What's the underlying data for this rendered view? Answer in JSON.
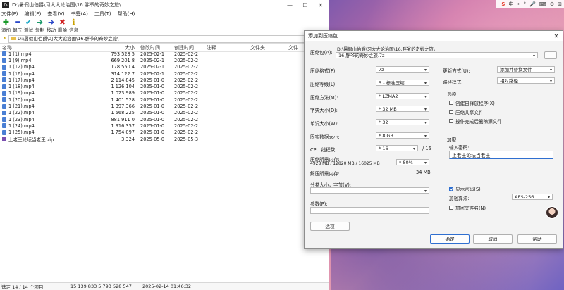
{
  "main_window": {
    "title": "D:\\暑假山伯爵\\习大大论治国\\16.胖爷的奇妙之旅\\",
    "app_icon": "7z",
    "menu": [
      "文件(F)",
      "编辑(E)",
      "查看(V)",
      "书签(A)",
      "工具(T)",
      "帮助(H)"
    ],
    "toolbar": [
      {
        "label": "添加",
        "icon": "plus-icon",
        "glyph": "✚",
        "color": "#1a9a2a"
      },
      {
        "label": "解压",
        "icon": "minus-icon",
        "glyph": "━",
        "color": "#2a48c8"
      },
      {
        "label": "测试",
        "icon": "check-icon",
        "glyph": "✔",
        "color": "#1aa8c8"
      },
      {
        "label": "复制",
        "icon": "copy-arrow-icon",
        "glyph": "➜",
        "color": "#1a9a6a"
      },
      {
        "label": "移动",
        "icon": "move-arrow-icon",
        "glyph": "➜",
        "color": "#2a48c8"
      },
      {
        "label": "删除",
        "icon": "delete-icon",
        "glyph": "✖",
        "color": "#d02020"
      },
      {
        "label": "信息",
        "icon": "info-icon",
        "glyph": "ℹ",
        "color": "#c9a100"
      }
    ],
    "address": "D:\\暑假山伯爵\\习大大论治国\\16.胖爷的奇妙之旅\\",
    "columns": [
      "名称",
      "大小",
      "修改时间",
      "创建时间",
      "注释",
      "文件夹",
      "文件"
    ],
    "files": [
      {
        "name": "1 (1).mp4",
        "size": "793 528 5",
        "modified": "2025-02-1",
        "created": "2025-02-2"
      },
      {
        "name": "1 (9).mp4",
        "size": "669 201 8",
        "modified": "2025-02-1",
        "created": "2025-02-2"
      },
      {
        "name": "1 (12).mp4",
        "size": "178 550 4",
        "modified": "2025-02-1",
        "created": "2025-02-2"
      },
      {
        "name": "1 (16).mp4",
        "size": "314 122 7",
        "modified": "2025-02-1",
        "created": "2025-02-2"
      },
      {
        "name": "1 (17).mp4",
        "size": "2 114 845",
        "modified": "2025-01-0",
        "created": "2025-02-2"
      },
      {
        "name": "1 (18).mp4",
        "size": "1 126 104",
        "modified": "2025-01-0",
        "created": "2025-02-2"
      },
      {
        "name": "1 (19).mp4",
        "size": "1 023 989",
        "modified": "2025-01-0",
        "created": "2025-02-2"
      },
      {
        "name": "1 (20).mp4",
        "size": "1 401 528",
        "modified": "2025-01-0",
        "created": "2025-02-2"
      },
      {
        "name": "1 (21).mp4",
        "size": "1 397 366",
        "modified": "2025-01-0",
        "created": "2025-02-2"
      },
      {
        "name": "1 (22).mp4",
        "size": "1 568 225",
        "modified": "2025-01-0",
        "created": "2025-02-2"
      },
      {
        "name": "1 (23).mp4",
        "size": "881 911 0",
        "modified": "2025-01-0",
        "created": "2025-02-2"
      },
      {
        "name": "1 (24).mp4",
        "size": "1 916 357",
        "modified": "2025-01-0",
        "created": "2025-02-2"
      },
      {
        "name": "1 (25).mp4",
        "size": "1 754 097",
        "modified": "2025-01-0",
        "created": "2025-02-2"
      },
      {
        "name": "上老王论坛当老王.zip",
        "size": "3 324",
        "modified": "2025-05-0",
        "created": "2025-05-3"
      }
    ],
    "status": {
      "selection": "选定 14 / 14 个项目",
      "sizes": "15 139 833 5  793 528 547",
      "datetime": "2025-02-14 01:46:32"
    }
  },
  "dialog": {
    "title": "添加到压缩包",
    "archive_label": "压缩包(A):",
    "archive_dir": "D:\\暑假山伯爵\\习大大论治国\\16.胖爷的奇妙之旅\\",
    "archive_name": "16.胖爷的奇妙之旅.7z",
    "browse": "...",
    "format_label": "压缩格式(F):",
    "format_value": "7z",
    "level_label": "压缩等级(L):",
    "level_value": "5 - 标准压缩",
    "method_label": "压缩方法(M):",
    "method_value": "* LZMA2",
    "dict_label": "字典大小(D):",
    "dict_value": "* 32 MB",
    "word_label": "单词大小(W):",
    "word_value": "* 32",
    "solid_label": "固实数据大小:",
    "solid_value": "* 8 GB",
    "cpu_label": "CPU 线程数:",
    "cpu_value": "* 16",
    "cpu_max": "/ 16",
    "mem_label": "压缩所需内存:",
    "mem_detail": "4928 MB / 12820 MB / 16025 MB",
    "mem_value": "* 80%",
    "decomp_label": "解压所需内存:",
    "decomp_value": "34 MB",
    "split_label": "分卷大小，字节(V):",
    "params_label": "参数(P):",
    "options_button": "选项",
    "update_label": "更新方式(U):",
    "update_value": "添加并替换文件",
    "pathmode_label": "路径模式:",
    "pathmode_value": "相对路径",
    "options_group": "选项",
    "opt_sfx": "创建自释放程序(X)",
    "opt_shared": "压缩共享文件",
    "opt_delete": "操作完成后删除源文件",
    "encrypt_group": "加密",
    "pwd_label": "输入密码:",
    "pwd_value": "上老王论坛当老王",
    "show_pwd": "显示密码(S)",
    "enc_method_label": "加密算法:",
    "enc_method_value": "AES-256",
    "encrypt_names": "加密文件名(N)",
    "ok": "确定",
    "cancel": "取消",
    "help": "帮助"
  },
  "tray": {
    "ime": "S",
    "items": [
      "中",
      "•",
      "°",
      "🎤",
      "⌨",
      "⚙",
      "⊞"
    ]
  }
}
